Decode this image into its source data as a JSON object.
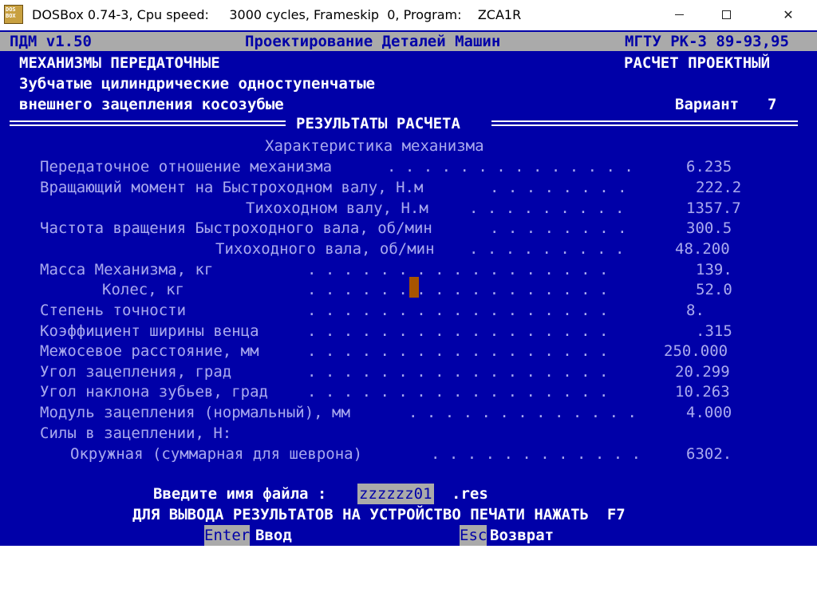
{
  "window": {
    "title": "DOSBox 0.74-3, Cpu speed:     3000 cycles, Frameskip  0, Program:    ZCA1R",
    "icon_text": "DOS\nBOX",
    "min_label": "",
    "close_label": "✕"
  },
  "header": {
    "left": "ПДМ v1.50",
    "center": "Проектирование Деталей Машин",
    "right": "МГТУ РК-3 89-93,95"
  },
  "info": {
    "category": "МЕХАНИЗМЫ ПЕРЕДАТОЧНЫЕ",
    "mode": "РАСЧЕТ ПРОЕКТНЫЙ",
    "desc1": "Зубчатые цилиндрические одноступенчатые",
    "desc2": "внешнего зацепления косозубые",
    "variant_label": "Вариант",
    "variant_value": "7"
  },
  "section_title": "РЕЗУЛЬТАТЫ РАСЧЕТА",
  "subtitle": "Характеристика механизма",
  "rows": [
    {
      "label": "Передаточное отношение механизма",
      "dots": ". . . . . . . . . . . . . .",
      "value": "6.235"
    },
    {
      "label": "Вращающий момент на Быстроходном валу, Н.м",
      "dots": ". . . . . . . .",
      "value": "222.2"
    },
    {
      "label": "Тихоходном валу, Н.м",
      "dots": ". . . . . . . . .",
      "value": "1357.7"
    },
    {
      "label": "Частота вращения Быстроходного вала, об/мин",
      "dots": ". . . . . . . .",
      "value": "300.5"
    },
    {
      "label": "Тихоходного вала, об/мин",
      "dots": ". . . . . . . . .",
      "value": "48.200"
    },
    {
      "label": "Масса Механизма, кг",
      "dots": ". . . . . . . . . . . . . . . . .",
      "value": "139."
    },
    {
      "label": "Колес, кг",
      "dots": ". . . . . . . . . . . . . . . . .",
      "value": "52.0"
    },
    {
      "label": "Степень точности",
      "dots": ". . . . . . . . . . . . . . . . .",
      "value": "8."
    },
    {
      "label": "Коэффициент ширины венца",
      "dots": ". . . . . . . . . . . . . . . . .",
      "value": ".315"
    },
    {
      "label": "Межосевое расстояние, мм",
      "dots": ". . . . . . . . . . . . . . . . .",
      "value": "250.000"
    },
    {
      "label": "Угол зацепления, град",
      "dots": ". . . . . . . . . . . . . . . . .",
      "value": "20.299"
    },
    {
      "label": "Угол наклона зубьев, град",
      "dots": ". . . . . . . . . . . . . . . . .",
      "value": "10.263"
    },
    {
      "label": "Модуль зацепления (нормальный), мм",
      "dots": ". . . . . . . . . . . . .",
      "value": "4.000"
    },
    {
      "label": "Силы в зацеплении, Н:",
      "dots": "",
      "value": ""
    },
    {
      "label": "Окружная (суммарная для шеврона)",
      "dots": ". . . . . . . . . . . .",
      "value": "6302."
    }
  ],
  "prompt": {
    "label": "Введите имя файла :",
    "filename": "zzzzzz01",
    "ext": ".res"
  },
  "print_hint": "ДЛЯ ВЫВОДА РЕЗУЛЬТАТОВ НА УСТРОЙСТВО ПЕЧАТИ НАЖАТЬ  F7",
  "footer": {
    "enter_key": "Enter",
    "enter_label": "Ввод",
    "esc_key": "Esc",
    "esc_label": "Возврат"
  }
}
